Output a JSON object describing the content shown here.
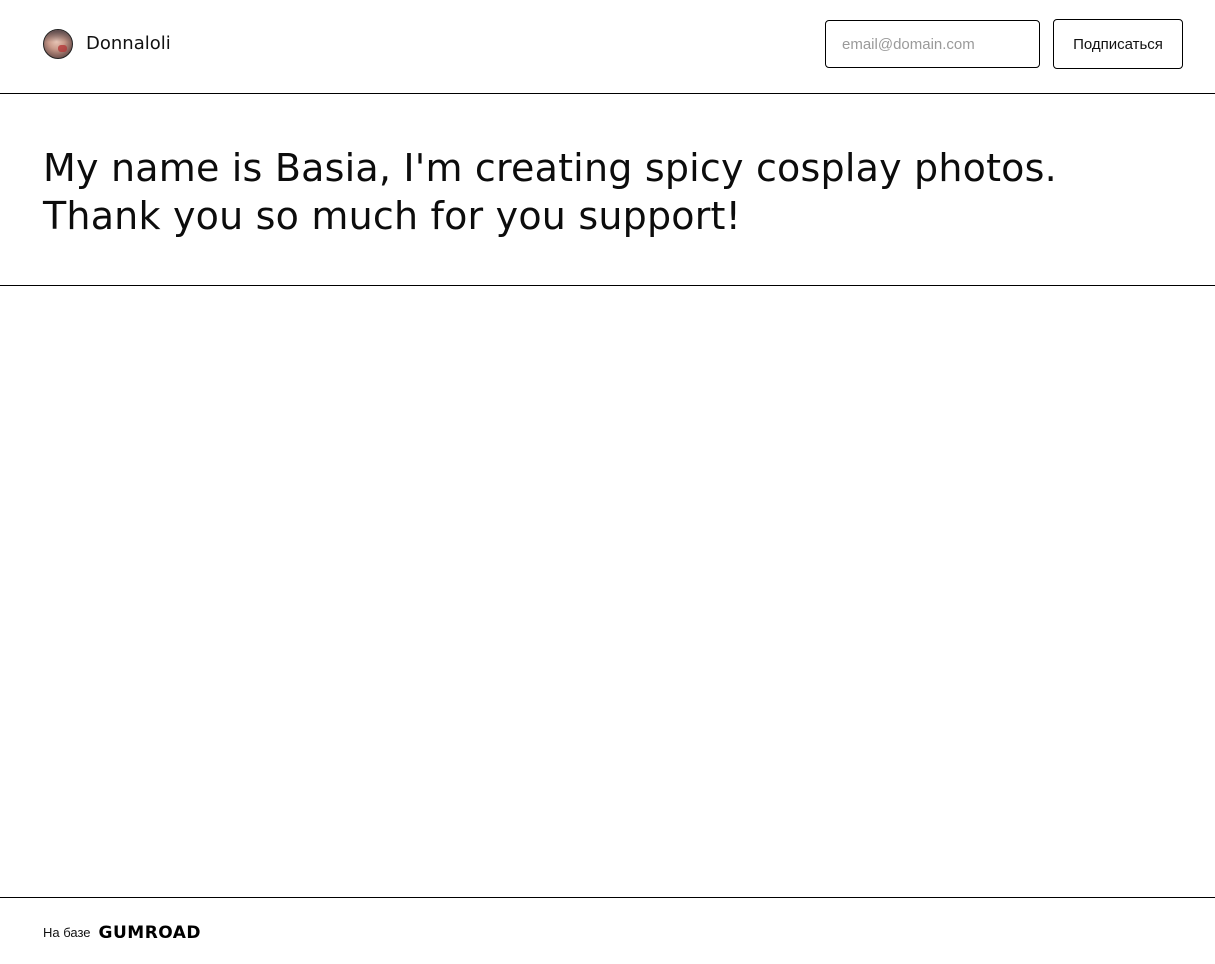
{
  "header": {
    "profile_name": "Donnaloli",
    "email_placeholder": "email@domain.com",
    "email_value": "",
    "subscribe_label": "Подписаться"
  },
  "intro": {
    "text": "My name is Basia, I'm creating spicy cosplay photos. Thank you so much for you support!"
  },
  "footer": {
    "powered_label": "На базе",
    "brand": "GUMROAD"
  },
  "icons": {
    "avatar": "avatar-image",
    "logo": "gumroad-logo"
  },
  "colors": {
    "background": "#ffffff",
    "border": "#000000",
    "text": "#111111",
    "placeholder": "#9a9a9a"
  }
}
